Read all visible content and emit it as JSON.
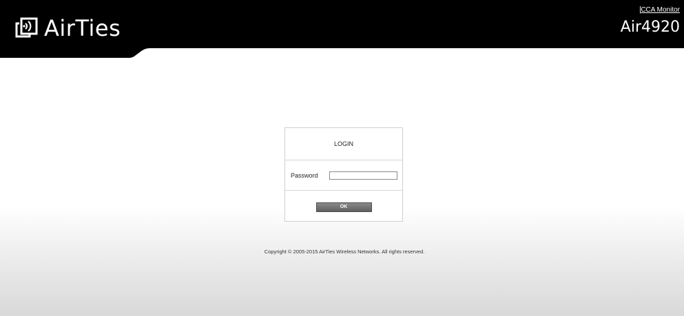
{
  "header": {
    "brand": "AirTies",
    "brand_logo_icon": "airties-logo-icon",
    "separator": "|",
    "monitor_link": "CCA Monitor",
    "model": "Air4920"
  },
  "login": {
    "title": "LOGIN",
    "password_label": "Password",
    "password_value": "",
    "ok_label": "OK"
  },
  "footer": {
    "copyright": "Copyright © 2005-2015 AirTies Wireless Networks. All rights reserved."
  },
  "colors": {
    "header_bg": "#000000",
    "button_bg": "#6e6e6e",
    "page_bg": "#ffffff"
  }
}
